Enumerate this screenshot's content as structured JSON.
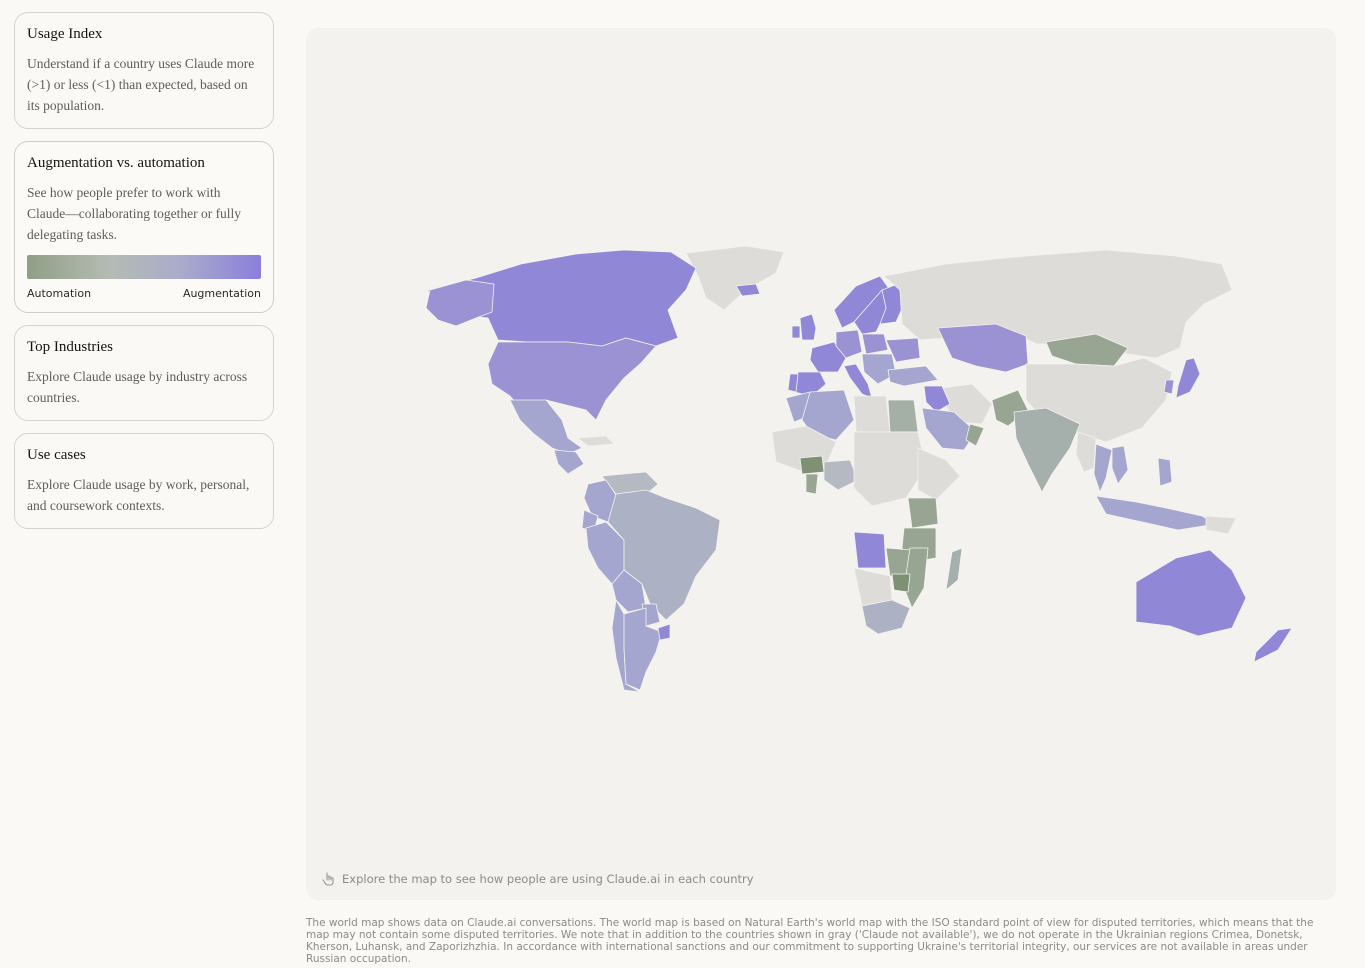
{
  "cards": [
    {
      "title": "Usage Index",
      "description": "Understand if a country uses Claude more (>1) or less (<1) than expected, based on its population."
    },
    {
      "title": "Augmentation vs. automation",
      "description": "See how people prefer to work with Claude—collaborating together or fully delegating tasks.",
      "legend": {
        "left_label": "Automation",
        "right_label": "Augmentation",
        "colors": [
          "#909e86",
          "#b5bbb3",
          "#aaaccb",
          "#8b7fdb"
        ]
      }
    },
    {
      "title": "Top Industries",
      "description": "Explore Claude usage by industry across countries."
    },
    {
      "title": "Use cases",
      "description": "Explore Claude usage by work, personal, and coursework contexts."
    }
  ],
  "map": {
    "hint_text": "Explore the map to see how people are using Claude.ai in each country",
    "hint_icon": "pointer-hand-icon",
    "colors": {
      "augmentation": "#9088d6",
      "mid_purple": "#a4a6cf",
      "neutral": "#b4b9c2",
      "automation": "#98a593",
      "not_available": "#dddcd9"
    }
  },
  "footnote": "The world map shows data on Claude.ai conversations. The world map is based on Natural Earth's world map with the ISO standard point of view for disputed territories, which means that the map may not contain some disputed territories. We note that in addition to the countries shown in gray ('Claude not available'), we do not operate in the Ukrainian regions Crimea, Donetsk, Kherson, Luhansk, and Zaporizhzhia. In accordance with international sanctions and our commitment to supporting Ukraine's territorial integrity, our services are not available in areas under Russian occupation."
}
